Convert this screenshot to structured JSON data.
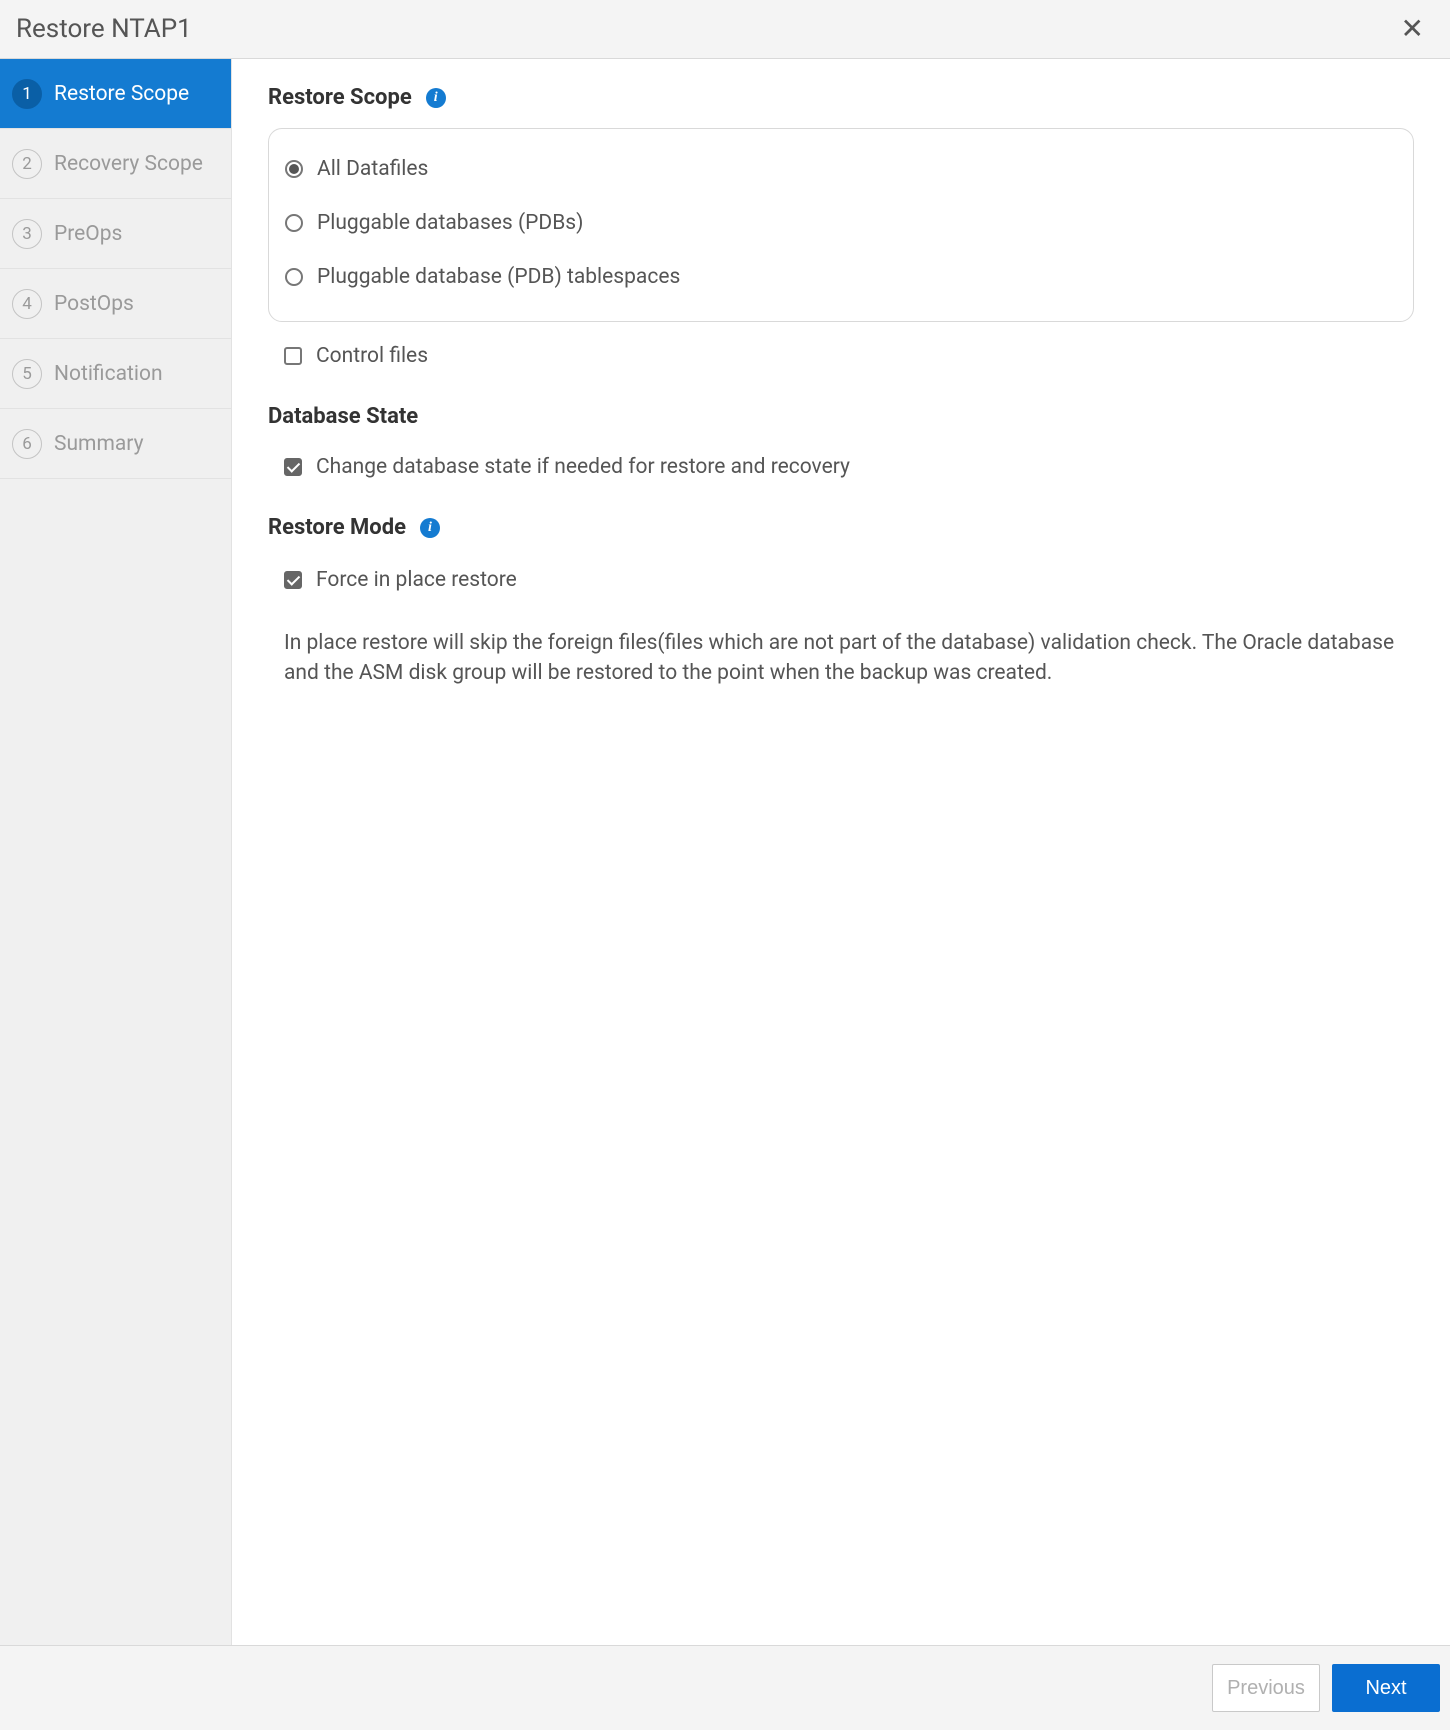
{
  "title": "Restore NTAP1",
  "steps": [
    {
      "num": "1",
      "label": "Restore Scope",
      "active": true
    },
    {
      "num": "2",
      "label": "Recovery Scope",
      "active": false
    },
    {
      "num": "3",
      "label": "PreOps",
      "active": false
    },
    {
      "num": "4",
      "label": "PostOps",
      "active": false
    },
    {
      "num": "5",
      "label": "Notification",
      "active": false
    },
    {
      "num": "6",
      "label": "Summary",
      "active": false
    }
  ],
  "restoreScope": {
    "heading": "Restore Scope",
    "options": {
      "allDatafiles": "All Datafiles",
      "pdbs": "Pluggable databases (PDBs)",
      "pdbTablespaces": "Pluggable database (PDB) tablespaces"
    },
    "selected": "allDatafiles",
    "controlFilesLabel": "Control files",
    "controlFilesChecked": false
  },
  "databaseState": {
    "heading": "Database State",
    "changeStateLabel": "Change database state if needed for restore and recovery",
    "changeStateChecked": true
  },
  "restoreMode": {
    "heading": "Restore Mode",
    "forceInPlaceLabel": "Force in place restore",
    "forceInPlaceChecked": true,
    "description": "In place restore will skip the foreign files(files which are not part of the database) validation check. The Oracle database and the ASM disk group will be restored to the point when the backup was created."
  },
  "footer": {
    "previous": "Previous",
    "next": "Next"
  }
}
